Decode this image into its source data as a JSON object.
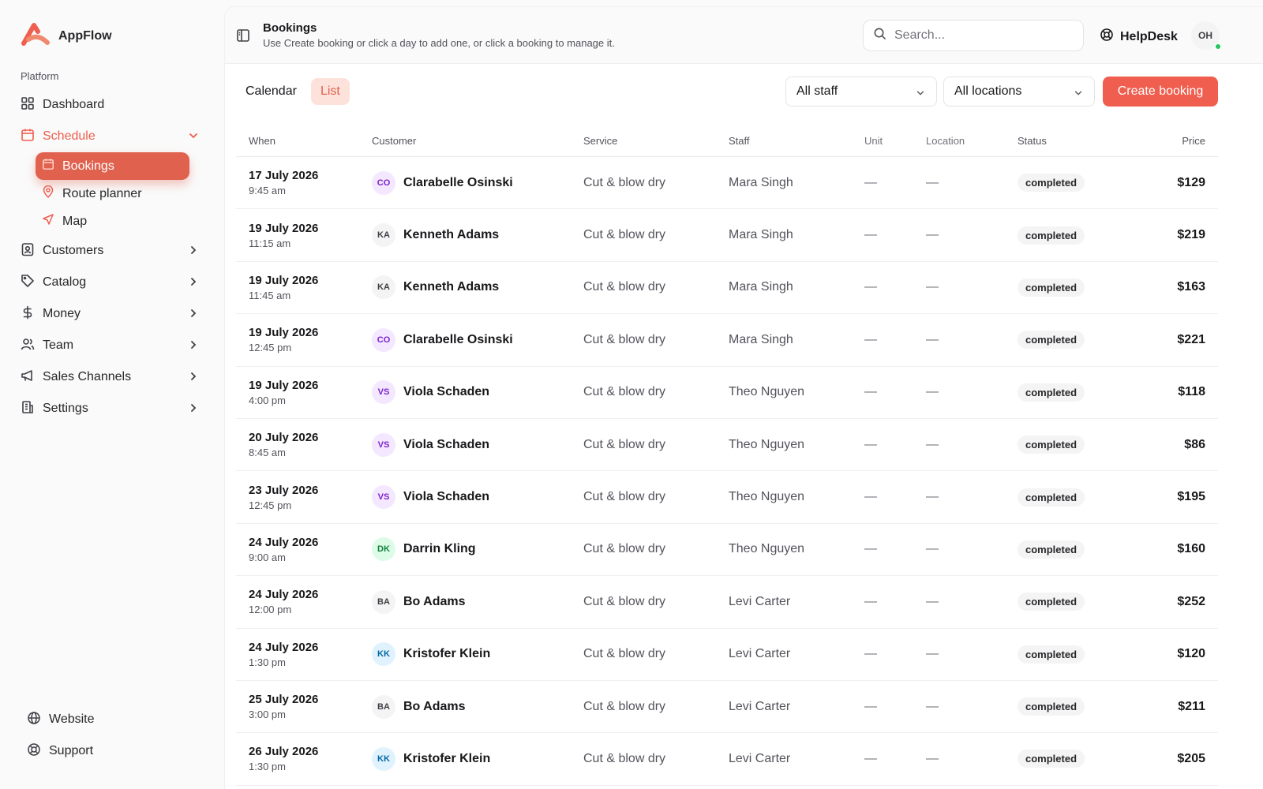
{
  "app": {
    "name": "AppFlow"
  },
  "sidebar": {
    "section_label": "Platform",
    "dashboard": "Dashboard",
    "schedule": "Schedule",
    "schedule_children": [
      "Bookings",
      "Route planner",
      "Map"
    ],
    "customers": "Customers",
    "catalog": "Catalog",
    "money": "Money",
    "team": "Team",
    "sales_channels": "Sales Channels",
    "settings": "Settings",
    "website": "Website",
    "support": "Support"
  },
  "header": {
    "title": "Bookings",
    "subtitle": "Use Create booking or click a day to add one, or click a booking to manage it.",
    "search_placeholder": "Search...",
    "helpdesk": "HelpDesk",
    "user_initials": "OH"
  },
  "toolbar": {
    "tabs": [
      "Calendar",
      "List"
    ],
    "active_tab": "List",
    "staff_filter": "All staff",
    "location_filter": "All locations",
    "create_label": "Create booking"
  },
  "colors": {
    "accent": "#ef5e4e",
    "active_tab_bg": "#fde2dc",
    "online": "#22c55e"
  },
  "table": {
    "columns": [
      "When",
      "Customer",
      "Service",
      "Staff",
      "Unit",
      "Location",
      "Status",
      "Price"
    ],
    "rows": [
      {
        "date": "17 July 2026",
        "time": "9:45 am",
        "initials": "CO",
        "avatar_bg": "#f3e8ff",
        "avatar_fg": "#7e22ce",
        "customer": "Clarabelle Osinski",
        "service": "Cut & blow dry",
        "staff": "Mara Singh",
        "unit": "—",
        "location": "—",
        "status": "completed",
        "price": "$129"
      },
      {
        "date": "19 July 2026",
        "time": "11:15 am",
        "initials": "KA",
        "avatar_bg": "#f4f4f5",
        "avatar_fg": "#3f3f46",
        "customer": "Kenneth Adams",
        "service": "Cut & blow dry",
        "staff": "Mara Singh",
        "unit": "—",
        "location": "—",
        "status": "completed",
        "price": "$219"
      },
      {
        "date": "19 July 2026",
        "time": "11:45 am",
        "initials": "KA",
        "avatar_bg": "#f4f4f5",
        "avatar_fg": "#3f3f46",
        "customer": "Kenneth Adams",
        "service": "Cut & blow dry",
        "staff": "Mara Singh",
        "unit": "—",
        "location": "—",
        "status": "completed",
        "price": "$163"
      },
      {
        "date": "19 July 2026",
        "time": "12:45 pm",
        "initials": "CO",
        "avatar_bg": "#f3e8ff",
        "avatar_fg": "#7e22ce",
        "customer": "Clarabelle Osinski",
        "service": "Cut & blow dry",
        "staff": "Mara Singh",
        "unit": "—",
        "location": "—",
        "status": "completed",
        "price": "$221"
      },
      {
        "date": "19 July 2026",
        "time": "4:00 pm",
        "initials": "VS",
        "avatar_bg": "#f3e8ff",
        "avatar_fg": "#7e22ce",
        "customer": "Viola Schaden",
        "service": "Cut & blow dry",
        "staff": "Theo Nguyen",
        "unit": "—",
        "location": "—",
        "status": "completed",
        "price": "$118"
      },
      {
        "date": "20 July 2026",
        "time": "8:45 am",
        "initials": "VS",
        "avatar_bg": "#f3e8ff",
        "avatar_fg": "#7e22ce",
        "customer": "Viola Schaden",
        "service": "Cut & blow dry",
        "staff": "Theo Nguyen",
        "unit": "—",
        "location": "—",
        "status": "completed",
        "price": "$86"
      },
      {
        "date": "23 July 2026",
        "time": "12:45 pm",
        "initials": "VS",
        "avatar_bg": "#f3e8ff",
        "avatar_fg": "#7e22ce",
        "customer": "Viola Schaden",
        "service": "Cut & blow dry",
        "staff": "Theo Nguyen",
        "unit": "—",
        "location": "—",
        "status": "completed",
        "price": "$195"
      },
      {
        "date": "24 July 2026",
        "time": "9:00 am",
        "initials": "DK",
        "avatar_bg": "#dcfce7",
        "avatar_fg": "#15803d",
        "customer": "Darrin Kling",
        "service": "Cut & blow dry",
        "staff": "Theo Nguyen",
        "unit": "—",
        "location": "—",
        "status": "completed",
        "price": "$160"
      },
      {
        "date": "24 July 2026",
        "time": "12:00 pm",
        "initials": "BA",
        "avatar_bg": "#f4f4f5",
        "avatar_fg": "#3f3f46",
        "customer": "Bo Adams",
        "service": "Cut & blow dry",
        "staff": "Levi Carter",
        "unit": "—",
        "location": "—",
        "status": "completed",
        "price": "$252"
      },
      {
        "date": "24 July 2026",
        "time": "1:30 pm",
        "initials": "KK",
        "avatar_bg": "#e0f2fe",
        "avatar_fg": "#0369a1",
        "customer": "Kristofer Klein",
        "service": "Cut & blow dry",
        "staff": "Levi Carter",
        "unit": "—",
        "location": "—",
        "status": "completed",
        "price": "$120"
      },
      {
        "date": "25 July 2026",
        "time": "3:00 pm",
        "initials": "BA",
        "avatar_bg": "#f4f4f5",
        "avatar_fg": "#3f3f46",
        "customer": "Bo Adams",
        "service": "Cut & blow dry",
        "staff": "Levi Carter",
        "unit": "—",
        "location": "—",
        "status": "completed",
        "price": "$211"
      },
      {
        "date": "26 July 2026",
        "time": "1:30 pm",
        "initials": "KK",
        "avatar_bg": "#e0f2fe",
        "avatar_fg": "#0369a1",
        "customer": "Kristofer Klein",
        "service": "Cut & blow dry",
        "staff": "Levi Carter",
        "unit": "—",
        "location": "—",
        "status": "completed",
        "price": "$205"
      }
    ]
  }
}
